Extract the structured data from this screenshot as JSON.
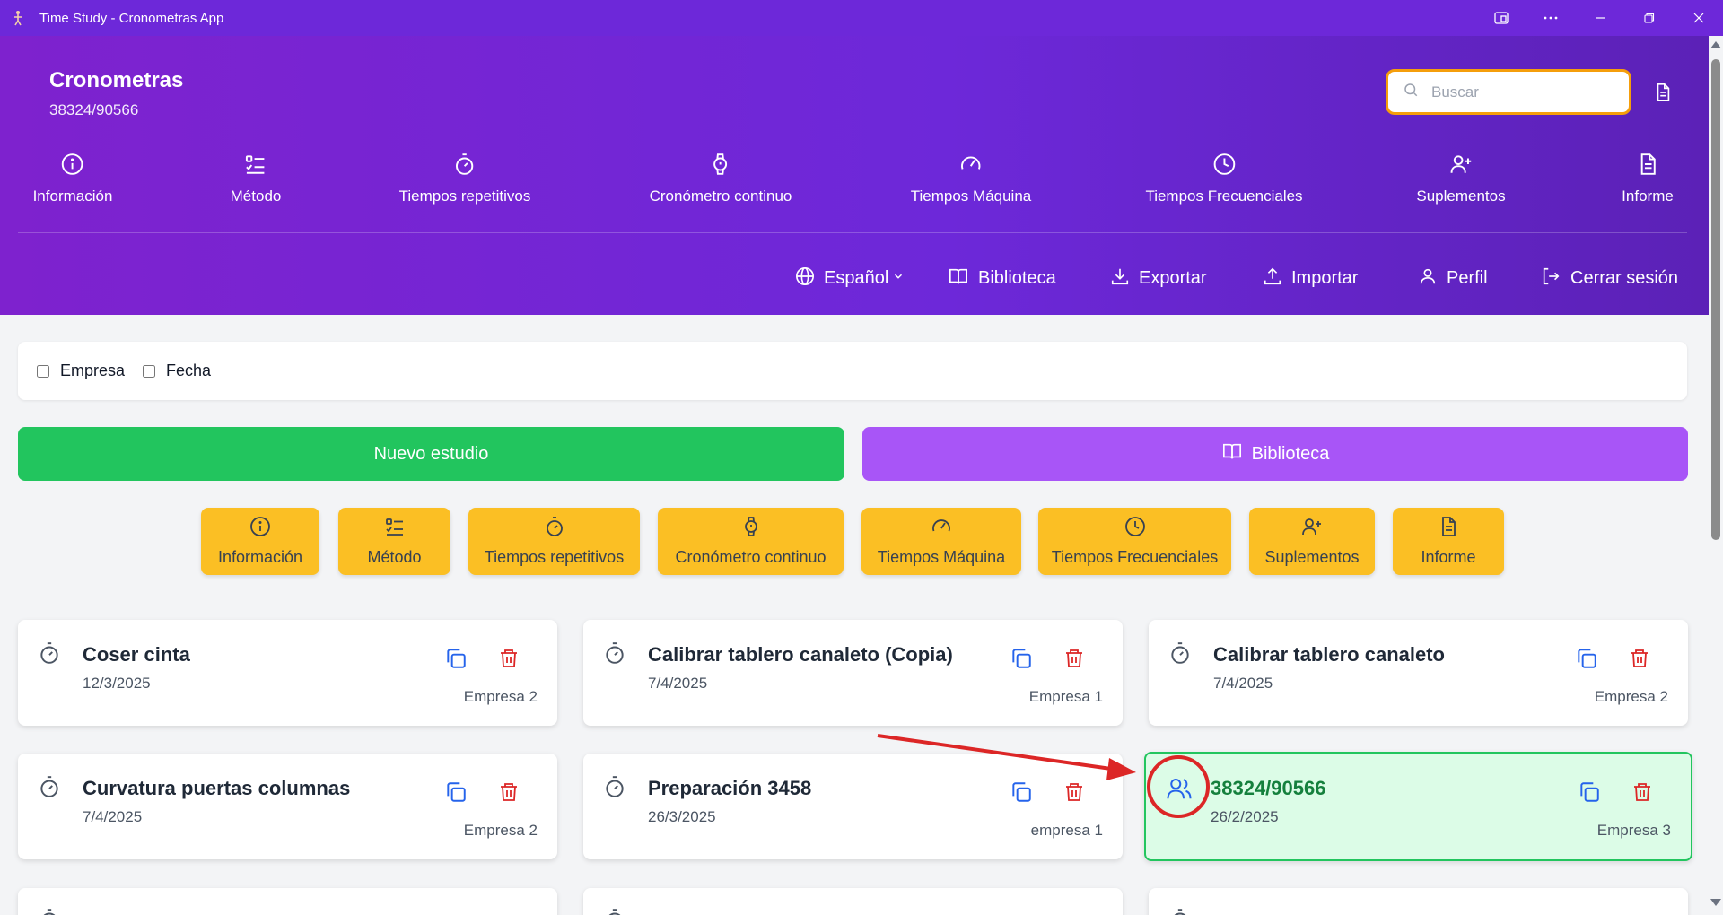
{
  "window": {
    "title": "Time Study - Cronometras App",
    "icons": [
      "app-icon",
      "window-snap-icon",
      "more-icon",
      "minimize-icon",
      "restore-icon",
      "close-icon"
    ]
  },
  "header": {
    "title": "Cronometras",
    "subtitle": "38324/90566",
    "search": {
      "placeholder": "Buscar",
      "value": ""
    },
    "nav": [
      {
        "label": "Información",
        "icon": "info-icon"
      },
      {
        "label": "Método",
        "icon": "list-check-icon"
      },
      {
        "label": "Tiempos repetitivos",
        "icon": "stopwatch-icon"
      },
      {
        "label": "Cronómetro continuo",
        "icon": "watch-icon"
      },
      {
        "label": "Tiempos Máquina",
        "icon": "gauge-icon"
      },
      {
        "label": "Tiempos Frecuenciales",
        "icon": "clock-icon"
      },
      {
        "label": "Suplementos",
        "icon": "user-plus-icon"
      },
      {
        "label": "Informe",
        "icon": "document-icon"
      }
    ],
    "utilities": {
      "language": "Español",
      "library": "Biblioteca",
      "export": "Exportar",
      "import": "Importar",
      "profile": "Perfil",
      "logout": "Cerrar sesión"
    }
  },
  "filters": [
    {
      "label": "Empresa",
      "checked": false
    },
    {
      "label": "Fecha",
      "checked": false
    }
  ],
  "actions": {
    "new_study": "Nuevo estudio",
    "library": "Biblioteca"
  },
  "quick_actions": [
    {
      "label": "Información",
      "icon": "info-icon"
    },
    {
      "label": "Método",
      "icon": "list-check-icon"
    },
    {
      "label": "Tiempos repetitivos",
      "icon": "stopwatch-icon"
    },
    {
      "label": "Cronómetro continuo",
      "icon": "watch-icon"
    },
    {
      "label": "Tiempos Máquina",
      "icon": "gauge-icon"
    },
    {
      "label": "Tiempos Frecuenciales",
      "icon": "clock-icon"
    },
    {
      "label": "Suplementos",
      "icon": "user-plus-icon"
    },
    {
      "label": "Informe",
      "icon": "document-icon"
    }
  ],
  "studies": [
    {
      "title": "Coser cinta",
      "date": "12/3/2025",
      "company": "Empresa 2",
      "icon": "stopwatch-icon",
      "highlighted": false
    },
    {
      "title": "Calibrar tablero canaleto (Copia)",
      "date": "7/4/2025",
      "company": "Empresa 1",
      "icon": "stopwatch-icon",
      "highlighted": false
    },
    {
      "title": "Calibrar tablero canaleto",
      "date": "7/4/2025",
      "company": "Empresa 2",
      "icon": "stopwatch-icon",
      "highlighted": false
    },
    {
      "title": "Curvatura puertas columnas",
      "date": "7/4/2025",
      "company": "Empresa 2",
      "icon": "stopwatch-icon",
      "highlighted": false
    },
    {
      "title": "Preparación 3458",
      "date": "26/3/2025",
      "company": "empresa 1",
      "icon": "stopwatch-icon",
      "highlighted": false
    },
    {
      "title": "38324/90566",
      "date": "26/2/2025",
      "company": "Empresa 3",
      "icon": "users-icon",
      "highlighted": true
    }
  ],
  "colors": {
    "header": "#6d28d9",
    "new_study": "#22c55e",
    "library": "#a855f7",
    "quick_action": "#fbbf24",
    "copy_icon": "#2563eb",
    "delete_icon": "#dc2626",
    "highlight_bg": "#dcfce7",
    "highlight_border": "#22c55e",
    "annotation": "#dc2626"
  }
}
